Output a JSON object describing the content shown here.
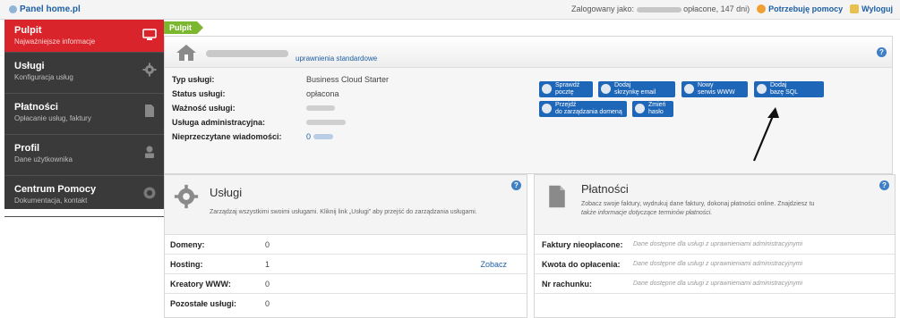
{
  "topbar": {
    "logo": "Panel home.pl",
    "logged_in_prefix": "Zalogowany jako:",
    "logged_in_status": "opłacone, 147 dni)",
    "help_link": "Potrzebuję pomocy",
    "logout_link": "Wyloguj"
  },
  "sidebar": {
    "items": [
      {
        "title": "Pulpit",
        "subtitle": "Najważniejsze informacje"
      },
      {
        "title": "Usługi",
        "subtitle": "Konfiguracja usług"
      },
      {
        "title": "Płatności",
        "subtitle": "Opłacanie usług, faktury"
      },
      {
        "title": "Profil",
        "subtitle": "Dane użytkownika"
      },
      {
        "title": "Centrum Pomocy",
        "subtitle": "Dokumentacja, kontakt"
      }
    ]
  },
  "breadcrumb": "Pulpit",
  "service": {
    "permissions_link": "uprawnienia standardowe",
    "help": "?",
    "details": [
      {
        "label": "Typ usługi:",
        "value": "Business Cloud Starter"
      },
      {
        "label": "Status usługi:",
        "value": "opłacona"
      },
      {
        "label": "Ważność usługi:",
        "value": ""
      },
      {
        "label": "Usługa administracyjna:",
        "value": ""
      },
      {
        "label": "Nieprzeczytane wiadomości:",
        "value": "0"
      }
    ],
    "actions": [
      {
        "line1": "Sprawdź",
        "line2": "pocztę"
      },
      {
        "line1": "Dodaj",
        "line2": "skrzynkę email"
      },
      {
        "line1": "Nowy",
        "line2": "serwis WWW"
      },
      {
        "line1": "Dodaj",
        "line2": "bazę SQL"
      },
      {
        "line1": "Przejdź",
        "line2": "do zarządzania domeną"
      },
      {
        "line1": "Zmień",
        "line2": "hasło"
      }
    ]
  },
  "services_box": {
    "title": "Usługi",
    "help": "?",
    "description": "Zarządzaj wszystkimi swoimi usługami. Kliknij link „Usługi” aby przejść do zarządzania usługami.",
    "rows": [
      {
        "label": "Domeny:",
        "value": "0",
        "link": ""
      },
      {
        "label": "Hosting:",
        "value": "1",
        "link": "Zobacz"
      },
      {
        "label": "Kreatory WWW:",
        "value": "0",
        "link": ""
      },
      {
        "label": "Pozostałe usługi:",
        "value": "0",
        "link": ""
      }
    ]
  },
  "payments_box": {
    "title": "Płatności",
    "help": "?",
    "description": "Zobacz swoje faktury, wydrukuj dane faktury, dokonaj płatności online. Znajdziesz tu",
    "link": "także informacje dotyczące terminów płatności.",
    "rows": [
      {
        "label": "Faktury nieopłacone:",
        "value": "Dane dostępne dla usługi z uprawnieniami administracyjnymi"
      },
      {
        "label": "Kwota do opłacenia:",
        "value": "Dane dostępne dla usługi z uprawnieniami administracyjnymi"
      },
      {
        "label": "Nr rachunku:",
        "value": "Dane dostępne dla usługi z uprawnieniami administracyjnymi"
      }
    ]
  },
  "colors": {
    "accent_red": "#d9242b",
    "sidebar_dark": "#3a3a3a",
    "button_blue": "#1e67b8",
    "breadcrumb_green": "#7cb82f"
  }
}
